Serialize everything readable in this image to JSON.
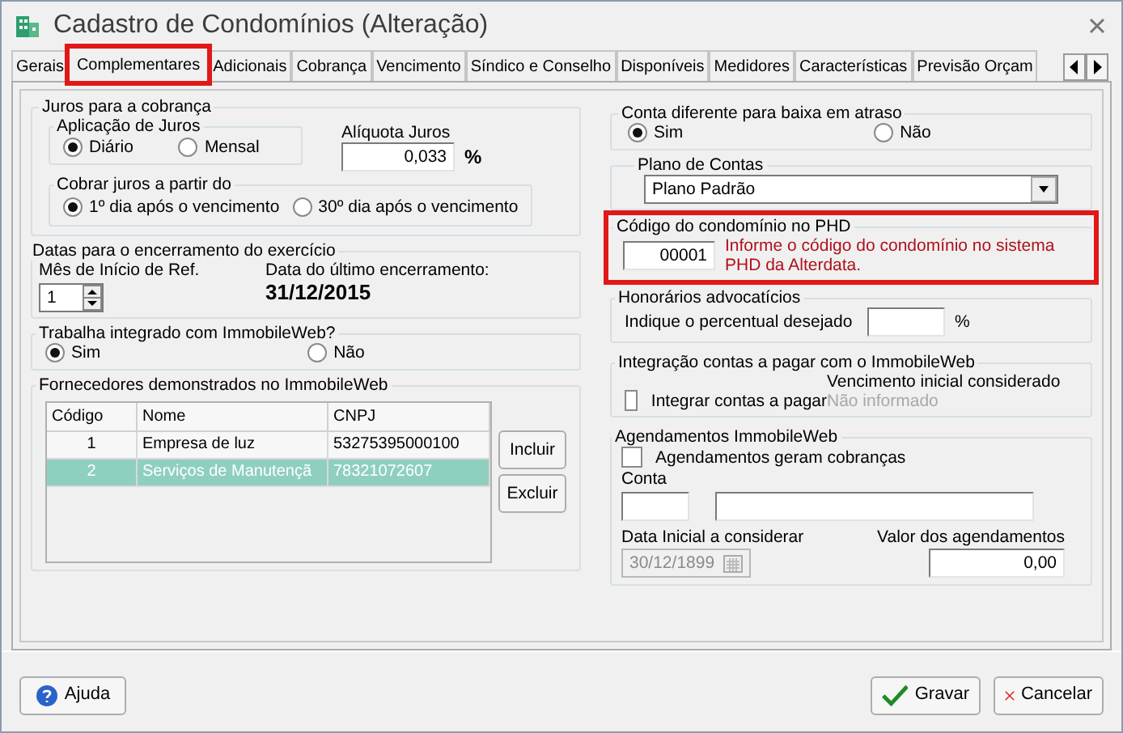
{
  "window": {
    "title": "Cadastro de Condomínios (Alteração)"
  },
  "tabs": [
    {
      "label": "Gerais",
      "selected": false,
      "highlighted": false
    },
    {
      "label": "Complementares",
      "selected": true,
      "highlighted": true
    },
    {
      "label": "Adicionais",
      "selected": false,
      "highlighted": false
    },
    {
      "label": "Cobrança",
      "selected": false,
      "highlighted": false
    },
    {
      "label": "Vencimento",
      "selected": false,
      "highlighted": false
    },
    {
      "label": "Síndico e Conselho",
      "selected": false,
      "highlighted": false
    },
    {
      "label": "Disponíveis",
      "selected": false,
      "highlighted": false
    },
    {
      "label": "Medidores",
      "selected": false,
      "highlighted": false
    },
    {
      "label": "Características",
      "selected": false,
      "highlighted": false
    },
    {
      "label": "Previsão Orçam",
      "selected": false,
      "highlighted": false
    }
  ],
  "juros": {
    "legend": "Juros para a cobrança",
    "aplicacao": {
      "legend": "Aplicação de Juros",
      "options": [
        {
          "label": "Diário",
          "selected": true
        },
        {
          "label": "Mensal",
          "selected": false
        }
      ]
    },
    "aliquota": {
      "label": "Alíquota Juros",
      "value": "0,033",
      "unit": "%"
    },
    "cobrar": {
      "legend": "Cobrar juros a partir do",
      "options": [
        {
          "label": "1º dia após o vencimento",
          "selected": true
        },
        {
          "label": "30º dia após o vencimento",
          "selected": false
        }
      ]
    }
  },
  "encerramento": {
    "legend": "Datas para o encerramento do exercício",
    "mes_label": "Mês de Início de Ref.",
    "mes_value": "1",
    "ultimo_label": "Data do último encerramento:",
    "ultimo_value": "31/12/2015"
  },
  "immobileweb": {
    "legend": "Trabalha integrado com ImmobileWeb?",
    "options": [
      {
        "label": "Sim",
        "selected": true
      },
      {
        "label": "Não",
        "selected": false
      }
    ]
  },
  "fornecedores": {
    "legend": "Fornecedores demonstrados no ImmobileWeb",
    "columns": [
      "Código",
      "Nome",
      "CNPJ"
    ],
    "rows": [
      {
        "cells": [
          "1",
          "Empresa de luz",
          "53275395000100"
        ],
        "selected": false
      },
      {
        "cells": [
          "2",
          "Serviços de Manutençã",
          "78321072607"
        ],
        "selected": true
      }
    ],
    "buttons": [
      "Incluir",
      "Excluir"
    ]
  },
  "conta_baixa": {
    "legend": "Conta diferente para baixa em atraso",
    "options": [
      {
        "label": "Sim",
        "selected": true
      },
      {
        "label": "Não",
        "selected": false
      }
    ]
  },
  "plano": {
    "legend": "Plano de Contas",
    "value": "Plano Padrão"
  },
  "phd": {
    "legend": "Código do condomínio no PHD",
    "value": "00001",
    "hint": "Informe o código do condomínio no sistema PHD da Alterdata.",
    "highlighted": true
  },
  "honorarios": {
    "legend": "Honorários advocatícios",
    "label": "Indique o percentual desejado",
    "unit": "%"
  },
  "integracao": {
    "legend": "Integração contas a pagar com o ImmobileWeb",
    "checkbox": {
      "label": "Integrar contas a pagar",
      "checked": false
    },
    "vencimento_label": "Vencimento inicial considerado",
    "vencimento_value": "Não informado"
  },
  "agendamentos": {
    "legend": "Agendamentos ImmobileWeb",
    "checkbox": {
      "label": "Agendamentos geram cobranças",
      "checked": false
    },
    "conta_label": "Conta",
    "data_label": "Data Inicial a considerar",
    "data_value": "30/12/1899",
    "valor_label": "Valor dos agendamentos",
    "valor_value": "0,00"
  },
  "footer_buttons": [
    {
      "label": "Ajuda",
      "kind": "help"
    },
    {
      "label": "Gravar",
      "kind": "save"
    },
    {
      "label": "Cancelar",
      "kind": "cancel"
    }
  ]
}
